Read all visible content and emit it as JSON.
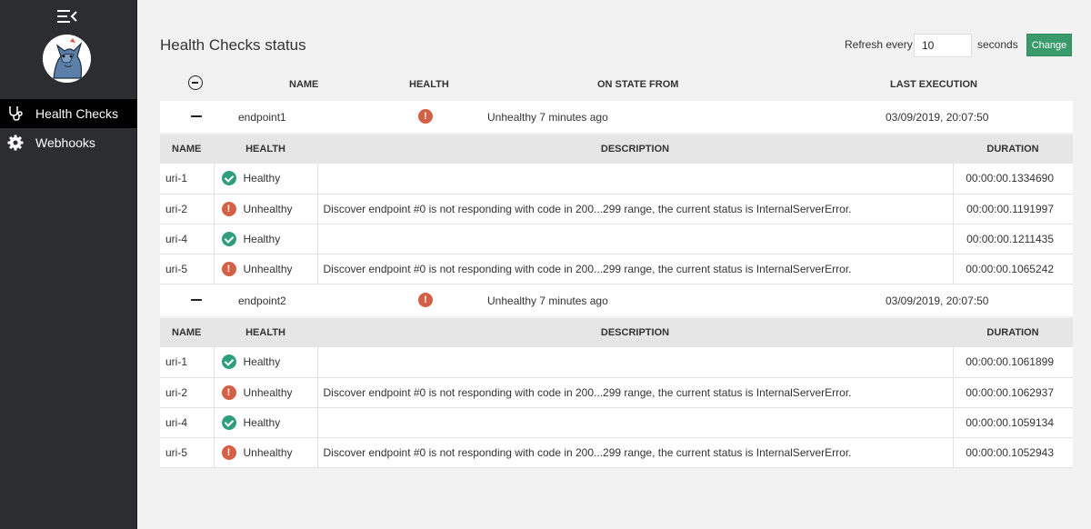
{
  "sidebar": {
    "items": [
      {
        "label": "Health Checks",
        "icon": "stethoscope-icon",
        "active": true
      },
      {
        "label": "Webhooks",
        "icon": "gear-icon",
        "active": false
      }
    ]
  },
  "header": {
    "title": "Health Checks status",
    "refresh_label": "Refresh every",
    "refresh_value": "10",
    "seconds_label": "seconds",
    "change_label": "Change"
  },
  "columns": {
    "name": "NAME",
    "health": "HEALTH",
    "on_state_from": "ON STATE FROM",
    "last_execution": "LAST EXECUTION"
  },
  "sub_columns": {
    "name": "NAME",
    "health": "HEALTH",
    "description": "DESCRIPTION",
    "duration": "DURATION"
  },
  "endpoints": [
    {
      "name": "endpoint1",
      "state": "Unhealthy 7 minutes ago",
      "last_execution": "03/09/2019, 20:07:50",
      "entries": [
        {
          "name": "uri-1",
          "health": "Healthy",
          "description": "",
          "duration": "00:00:00.1334690"
        },
        {
          "name": "uri-2",
          "health": "Unhealthy",
          "description": "Discover endpoint #0 is not responding with code in 200...299 range, the current status is InternalServerError.",
          "duration": "00:00:00.1191997"
        },
        {
          "name": "uri-4",
          "health": "Healthy",
          "description": "",
          "duration": "00:00:00.1211435"
        },
        {
          "name": "uri-5",
          "health": "Unhealthy",
          "description": "Discover endpoint #0 is not responding with code in 200...299 range, the current status is InternalServerError.",
          "duration": "00:00:00.1065242"
        }
      ]
    },
    {
      "name": "endpoint2",
      "state": "Unhealthy 7 minutes ago",
      "last_execution": "03/09/2019, 20:07:50",
      "entries": [
        {
          "name": "uri-1",
          "health": "Healthy",
          "description": "",
          "duration": "00:00:00.1061899"
        },
        {
          "name": "uri-2",
          "health": "Unhealthy",
          "description": "Discover endpoint #0 is not responding with code in 200...299 range, the current status is InternalServerError.",
          "duration": "00:00:00.1062937"
        },
        {
          "name": "uri-4",
          "health": "Healthy",
          "description": "",
          "duration": "00:00:00.1059134"
        },
        {
          "name": "uri-5",
          "health": "Unhealthy",
          "description": "Discover endpoint #0 is not responding with code in 200...299 range, the current status is InternalServerError.",
          "duration": "00:00:00.1052943"
        }
      ]
    }
  ],
  "colors": {
    "sidebar_bg": "#2c2d30",
    "accent_green": "#3b9a6c",
    "healthy": "#2f9e7d",
    "unhealthy": "#d46046"
  }
}
